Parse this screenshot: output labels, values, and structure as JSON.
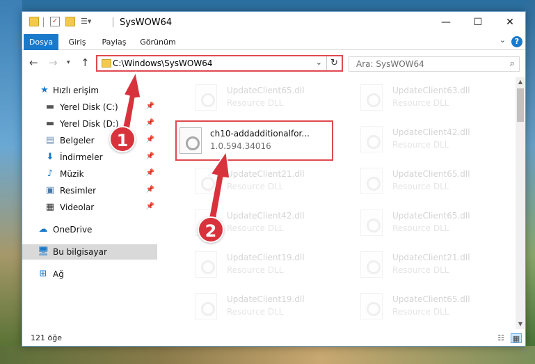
{
  "window": {
    "title": "SysWOW64",
    "controls": {
      "minimize": "—",
      "maximize": "☐",
      "close": "✕"
    }
  },
  "ribbon": {
    "tabs": [
      "Dosya",
      "Giriş",
      "Paylaş",
      "Görünüm"
    ],
    "active_tab": "Dosya",
    "help": "?"
  },
  "address": {
    "path": "C:\\Windows\\SysWOW64",
    "search_placeholder": "Ara: SysWOW64"
  },
  "sidebar": {
    "items": [
      {
        "label": "Hızlı erişim",
        "icon": "star-icon"
      },
      {
        "label": "Yerel Disk (C:)",
        "icon": "drive-icon",
        "pinned": true
      },
      {
        "label": "Yerel Disk (D:)",
        "icon": "drive-icon",
        "pinned": true
      },
      {
        "label": "Belgeler",
        "icon": "documents-icon",
        "pinned": true
      },
      {
        "label": "İndirmeler",
        "icon": "download-icon",
        "pinned": true
      },
      {
        "label": "Müzik",
        "icon": "music-icon",
        "pinned": true
      },
      {
        "label": "Resimler",
        "icon": "pictures-icon",
        "pinned": true
      },
      {
        "label": "Videolar",
        "icon": "video-icon",
        "pinned": true
      },
      {
        "label": "OneDrive",
        "icon": "cloud-icon"
      },
      {
        "label": "Bu bilgisayar",
        "icon": "computer-icon",
        "selected": true
      },
      {
        "label": "Ağ",
        "icon": "network-icon"
      }
    ]
  },
  "files": {
    "highlighted": {
      "name": "ch10-addadditionalfor...",
      "sub": "1.0.594.34016"
    },
    "faded": [
      {
        "name": "UpdateClient65.dll",
        "sub": "Resource DLL"
      },
      {
        "name": "UpdateClient63.dll",
        "sub": "Resource DLL"
      },
      {
        "name": "UpdateClient42.dll",
        "sub": "Resource DLL"
      },
      {
        "name": "UpdateClient21.dll",
        "sub": "Resource DLL"
      },
      {
        "name": "UpdateClient65.dll",
        "sub": "Resource DLL"
      },
      {
        "name": "UpdateClient42.dll",
        "sub": "Resource DLL"
      },
      {
        "name": "UpdateClient65.dll",
        "sub": "Resource DLL"
      },
      {
        "name": "UpdateClient19.dll",
        "sub": "Resource DLL"
      },
      {
        "name": "UpdateClient21.dll",
        "sub": "Resource DLL"
      },
      {
        "name": "UpdateClient19.dll",
        "sub": "Resource DLL"
      },
      {
        "name": "UpdateClient65.dll",
        "sub": "Resource DLL"
      }
    ]
  },
  "status": {
    "count": "121 öğe"
  },
  "annotations": {
    "step1": "1",
    "step2": "2",
    "color": "#d8333d"
  }
}
